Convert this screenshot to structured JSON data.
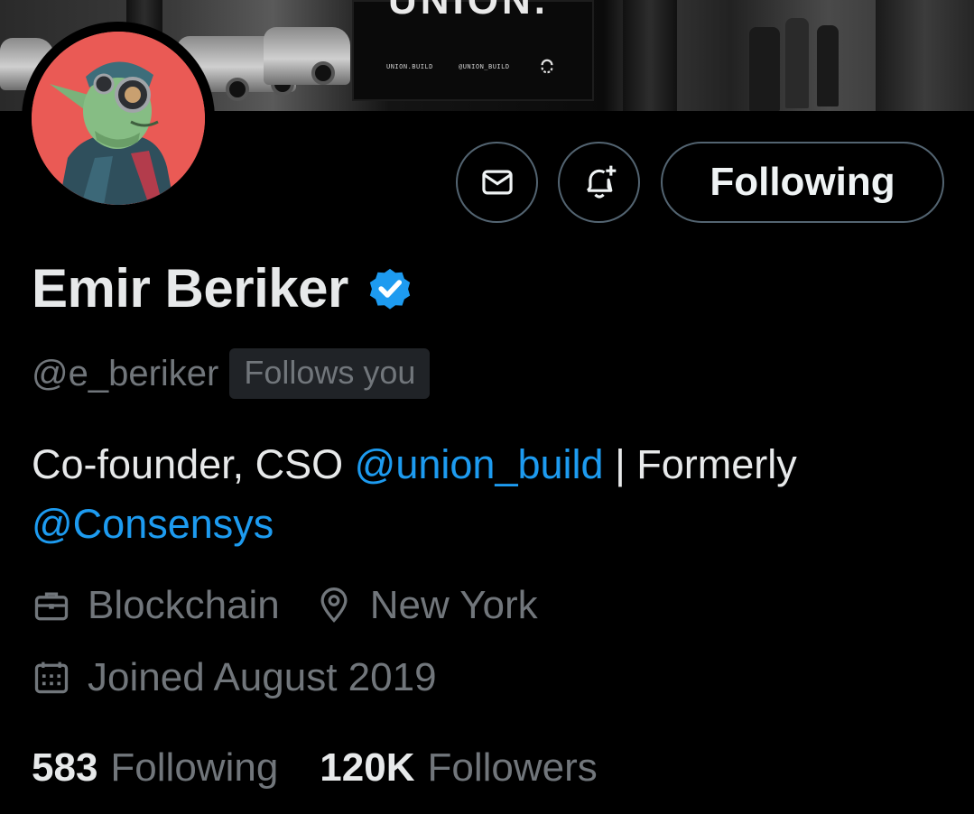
{
  "banner": {
    "sign_title": "UNION.",
    "sign_text_left": "UNION.BUILD",
    "sign_text_right": "@UNION_BUILD"
  },
  "profile": {
    "name": "Emir Beriker",
    "handle": "@e_beriker",
    "follows_you": "Follows you",
    "bio": {
      "part1": "Co-founder, CSO ",
      "mention1": "@union_build",
      "part2": " | Formerly ",
      "mention2": "@Consensys"
    },
    "category": "Blockchain",
    "location": "New York",
    "joined": "Joined August 2019",
    "following_count": "583",
    "following_label": "Following",
    "followers_count": "120K",
    "followers_label": "Followers"
  },
  "actions": {
    "follow_button": "Following",
    "message_icon": "envelope-icon",
    "notify_icon": "bell-plus-icon"
  },
  "colors": {
    "background": "#000000",
    "primary_text": "#e7e9ea",
    "secondary_text": "#71767b",
    "accent": "#1d9bf0",
    "border": "#536471"
  }
}
